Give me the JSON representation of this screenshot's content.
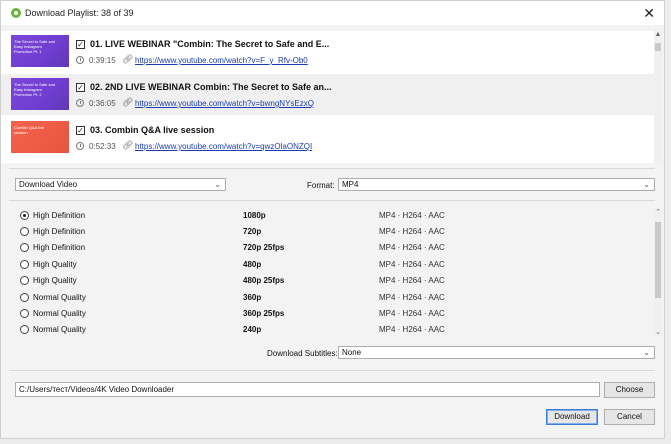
{
  "window": {
    "title": "Download Playlist: 38 of 39",
    "close_glyph": "✕"
  },
  "playlist": [
    {
      "title": "01. LIVE WEBINAR \"Combin: The Secret to Safe and E...",
      "duration": "0:39:15",
      "url": "https://www.youtube.com/watch?v=F_y_Rfv-Ob0",
      "checked": "✓",
      "thumb_text": "The Secret to Safe and Easy Instagram Promotion Pt. 1",
      "thumb_color": "#7546d6"
    },
    {
      "title": "02. 2ND LIVE WEBINAR Combin: The Secret to Safe an...",
      "duration": "0:36:05",
      "url": "https://www.youtube.com/watch?v=bwngNYsEzxQ",
      "checked": "✓",
      "thumb_text": "The Secret to Safe and Easy Instagram Promotion Pt. 2",
      "thumb_color": "#7546d6"
    },
    {
      "title": "03. Combin Q&A live session",
      "duration": "0:52:33",
      "url": "https://www.youtube.com/watch?v=qwzOlaONZQI",
      "checked": "✓",
      "thumb_text": "Combin Q&A live session",
      "thumb_color": "#f0604a"
    }
  ],
  "options": {
    "download_type": "Download Video",
    "format_label": "Format:",
    "format_value": "MP4"
  },
  "qualities": [
    {
      "name": "High Definition",
      "res": "1080p",
      "fmt": "MP4 · H264 · AAC",
      "selected": true
    },
    {
      "name": "High Definition",
      "res": "720p",
      "fmt": "MP4 · H264 · AAC",
      "selected": false
    },
    {
      "name": "High Definition",
      "res": "720p 25fps",
      "fmt": "MP4 · H264 · AAC",
      "selected": false
    },
    {
      "name": "High Quality",
      "res": "480p",
      "fmt": "MP4 · H264 · AAC",
      "selected": false
    },
    {
      "name": "High Quality",
      "res": "480p 25fps",
      "fmt": "MP4 · H264 · AAC",
      "selected": false
    },
    {
      "name": "Normal Quality",
      "res": "360p",
      "fmt": "MP4 · H264 · AAC",
      "selected": false
    },
    {
      "name": "Normal Quality",
      "res": "360p 25fps",
      "fmt": "MP4 · H264 · AAC",
      "selected": false
    },
    {
      "name": "Normal Quality",
      "res": "240p",
      "fmt": "MP4 · H264 · AAC",
      "selected": false
    }
  ],
  "subtitles": {
    "label": "Download Subtitles:",
    "value": "None"
  },
  "save_path": {
    "value": "C:/Users/тест/Videos/4K Video Downloader",
    "choose_label": "Choose"
  },
  "footer": {
    "download_label": "Download",
    "cancel_label": "Cancel"
  },
  "colors": {
    "accent": "#3b7bd1",
    "link": "#1a3db3",
    "app_icon": "#6cb33e"
  }
}
